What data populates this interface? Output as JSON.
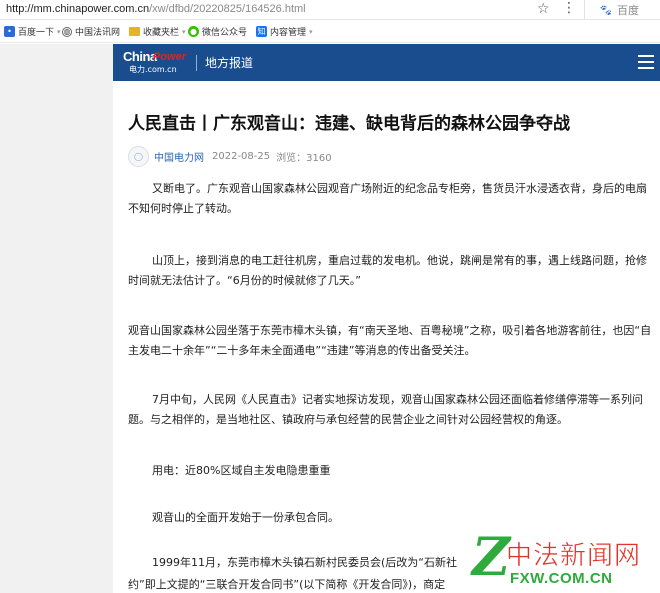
{
  "browser": {
    "url_host": "http://mm.chinapower.com.cn",
    "url_path": "/xw/dfbd/20220825/164526.html",
    "search_engine": "百度"
  },
  "bookmarks": [
    {
      "label": "百度一下",
      "icon": "baidu-paw-icon",
      "color": "#2b6bd8"
    },
    {
      "label": "中国法讯网",
      "icon": "globe-icon",
      "color": "#444444"
    },
    {
      "label": "收藏夹栏",
      "icon": "folder-icon",
      "color": "#e6b422"
    },
    {
      "label": "微信公众号",
      "icon": "wechat-icon",
      "color": "#2dc100"
    },
    {
      "label": "内容管理",
      "icon": "zhihu-icon",
      "color": "#1772f6"
    }
  ],
  "site": {
    "logo_text_1": "China",
    "logo_text_2": "Power",
    "logo_text_3": "电力",
    "logo_text_4": ".com.cn",
    "section": "地方报道"
  },
  "article": {
    "title": "人民直击丨广东观音山：违建、缺电背后的森林公园争夺战",
    "source": "中国电力网",
    "date": "2022-08-25",
    "views": "浏览：3160",
    "paragraphs": [
      "又断电了。广东观音山国家森林公园观音广场附近的纪念品专柜旁，售货员汗水浸透衣背，身后的电扇不知何时停止了转动。",
      "山顶上，接到消息的电工赶往机房，重启过载的发电机。他说，跳闸是常有的事，遇上线路问题，抢修时间就无法估计了。“6月份的时候就修了几天。”",
      "观音山国家森林公园坐落于东莞市樟木头镇，有“南天圣地、百粤秘境”之称，吸引着各地游客前往，也因“自主发电二十余年”“二十多年未全面通电”“违建”等消息的传出备受关注。",
      "7月中旬，人民网《人民直击》记者实地探访发现，观音山国家森林公园还面临着修缮停滞等一系列问题。与之相伴的，是当地社区、镇政府与承包经营的民营企业之间针对公园经营权的角逐。",
      "用电：近80%区域自主发电隐患重重",
      "观音山的全面开发始于一份承包合同。",
      "1999年11月，东莞市樟木头镇石新村民委员会(后改为“石新社",
      "约”即上文提的“三联合开发合同书”(以下简称《开发合同》)，商定"
    ]
  },
  "watermark": {
    "letter": "Z",
    "text": "中法新闻网",
    "domain": "FXW.COM.CN"
  }
}
